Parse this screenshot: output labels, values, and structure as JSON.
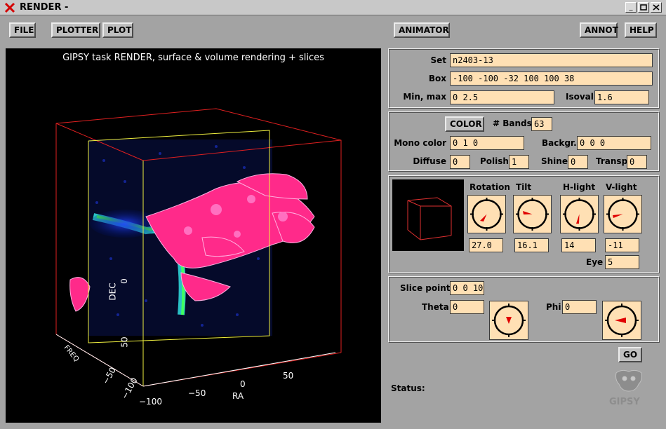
{
  "window": {
    "title": "RENDER -"
  },
  "menu": {
    "file": "FILE",
    "plotter": "PLOTTER",
    "plot": "PLOT",
    "animator": "ANIMATOR",
    "annot": "ANNOT",
    "help": "HELP"
  },
  "view": {
    "title": "GIPSY task RENDER, surface & volume rendering + slices",
    "axis_ra": "RA",
    "axis_dec": "DEC",
    "axis_third": "FREQ",
    "ra_ticks": [
      "−100",
      "−50",
      "0",
      "50"
    ],
    "dec_ticks": [
      "0",
      "50"
    ],
    "freq_ticks": [
      "−100",
      "−50"
    ]
  },
  "set_panel": {
    "set_label": "Set",
    "set_value": "n2403-13",
    "box_label": "Box",
    "box_value": "-100 -100 -32 100 100 38",
    "minmax_label": "Min, max",
    "minmax_value": "0 2.5",
    "isoval_label": "Isoval",
    "isoval_value": "1.6"
  },
  "color_panel": {
    "color_button": "COLOR",
    "bands_label": "# Bands",
    "bands_value": "63",
    "mono_label": "Mono color",
    "mono_value": "0 1 0",
    "backgr_label": "Backgr.",
    "backgr_value": "0 0 0",
    "diffuse_label": "Diffuse",
    "diffuse_value": "0",
    "polish_label": "Polish",
    "polish_value": "1",
    "shine_label": "Shine",
    "shine_value": "0",
    "transp_label": "Transp.",
    "transp_value": "0"
  },
  "orientation_panel": {
    "rotation_label": "Rotation",
    "rotation_value": "27.0",
    "tilt_label": "Tilt",
    "tilt_value": "16.1",
    "hlight_label": "H-light",
    "hlight_value": "14",
    "vlight_label": "V-light",
    "vlight_value": "-11",
    "eye_label": "Eye",
    "eye_value": "5"
  },
  "slice_panel": {
    "slice_label": "Slice point:",
    "slice_value": "0 0 10",
    "theta_label": "Theta",
    "theta_value": "0",
    "phi_label": "Phi",
    "phi_value": "0"
  },
  "go_button": "GO",
  "status_label": "Status:",
  "logo_text": "GIPSY",
  "colors": {
    "field_bg": "#ffe0b4",
    "window_bg": "#a3a3a3",
    "arrow": "#e00000"
  }
}
